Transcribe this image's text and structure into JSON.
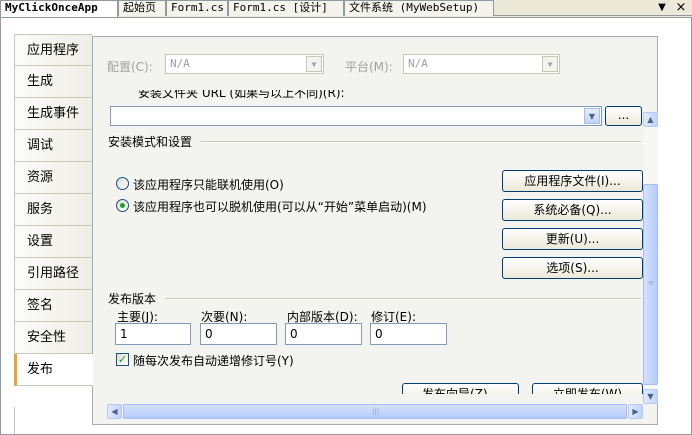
{
  "doc_tabs": [
    {
      "label": "MyClickOnceApp",
      "active": true
    },
    {
      "label": "起始页",
      "active": false
    },
    {
      "label": "Form1.cs",
      "active": false
    },
    {
      "label": "Form1.cs [设计]",
      "active": false
    },
    {
      "label": "文件系统 (MyWebSetup)",
      "active": false
    }
  ],
  "tab_controls": {
    "dropdown": "▼",
    "close": "×"
  },
  "side_tabs": [
    "应用程序",
    "生成",
    "生成事件",
    "调试",
    "资源",
    "服务",
    "设置",
    "引用路径",
    "签名",
    "安全性",
    "发布"
  ],
  "active_side_tab": "发布",
  "top_bar": {
    "config_label": "配置(C):",
    "config_value": "N/A",
    "platform_label": "平台(M):",
    "platform_value": "N/A"
  },
  "install_folder": {
    "label": "安装文件夹 URL (如果与以上不同)(R):",
    "value": "",
    "browse_label": "..."
  },
  "install_mode": {
    "group_label": "安装模式和设置",
    "options": [
      {
        "label": "该应用程序只能联机使用(O)",
        "selected": false
      },
      {
        "label": "该应用程序也可以脱机使用(可以从“开始”菜单启动)(M)",
        "selected": true
      }
    ],
    "buttons": {
      "app_files": "应用程序文件(I)...",
      "prerequisites": "系统必备(Q)...",
      "updates": "更新(U)...",
      "options": "选项(S)..."
    }
  },
  "publish_version": {
    "group_label": "发布版本",
    "major_label": "主要(J):",
    "minor_label": "次要(N):",
    "build_label": "内部版本(D):",
    "revision_label": "修订(E):",
    "major": "1",
    "minor": "0",
    "build": "0",
    "revision": "0",
    "auto_increment_label": "随每次发布自动递增修订号(Y)",
    "auto_increment": true
  },
  "actions": {
    "wizard": "发布向导(Z)...",
    "publish_now": "立即发布(W)"
  }
}
